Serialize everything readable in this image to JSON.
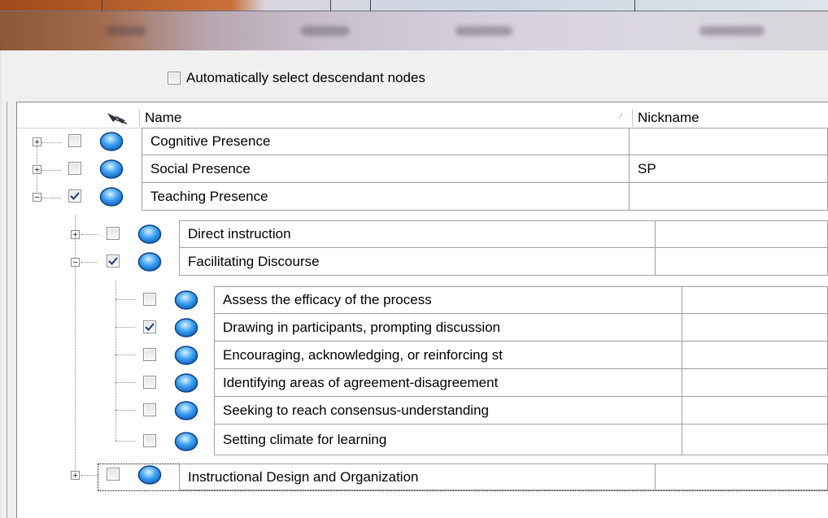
{
  "options": {
    "auto_select_label": "Automatically select descendant nodes",
    "auto_select_checked": false
  },
  "tree": {
    "columns": {
      "name": "Name",
      "nickname": "Nickname"
    },
    "nodes": [
      {
        "name": "Cognitive Presence",
        "nickname": "",
        "checked": false,
        "expanded": false
      },
      {
        "name": "Social Presence",
        "nickname": "SP",
        "checked": false,
        "expanded": false
      },
      {
        "name": "Teaching Presence",
        "nickname": "",
        "checked": true,
        "expanded": true,
        "children": [
          {
            "name": "Direct instruction",
            "nickname": "",
            "checked": false,
            "expanded": false
          },
          {
            "name": "Facilitating Discourse",
            "nickname": "",
            "checked": true,
            "expanded": true,
            "children": [
              {
                "name": "Assess the efficacy of the process",
                "nickname": "",
                "checked": false
              },
              {
                "name": "Drawing in participants, prompting discussion",
                "nickname": "",
                "checked": true
              },
              {
                "name": "Encouraging, acknowledging, or reinforcing st",
                "nickname": "",
                "checked": false
              },
              {
                "name": "Identifying areas of agreement-disagreement",
                "nickname": "",
                "checked": false
              },
              {
                "name": "Seeking to reach consensus-understanding",
                "nickname": "",
                "checked": false
              },
              {
                "name": "Setting climate for learning",
                "nickname": "",
                "checked": false
              }
            ]
          },
          {
            "name": "Instructional Design and Organization",
            "nickname": "",
            "checked": false,
            "expanded": false
          }
        ]
      }
    ]
  },
  "icons": {
    "node": "node-ellipse-icon",
    "pin": "pin-icon",
    "sort": "sort-indicator-icon"
  },
  "colors": {
    "node_fill": "#3aa0f0",
    "check": "#1c3a78",
    "border": "#a0a0a0"
  }
}
